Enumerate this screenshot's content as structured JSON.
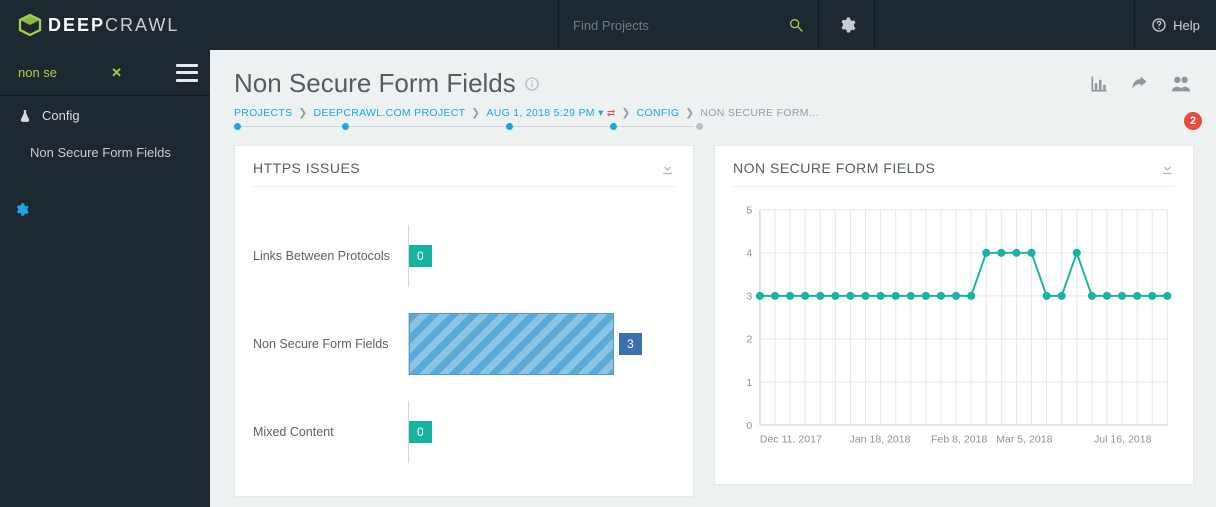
{
  "brand": {
    "bold": "DEEP",
    "light": "CRAWL"
  },
  "topbar": {
    "search_placeholder": "Find Projects",
    "help_label": "Help"
  },
  "sidebar": {
    "filter_text": "non se",
    "items": [
      {
        "icon": "flask",
        "label": "Config"
      },
      {
        "label": "Non Secure Form Fields"
      }
    ]
  },
  "page": {
    "title": "Non Secure Form Fields",
    "badge_count": "2"
  },
  "breadcrumb": [
    {
      "label": "PROJECTS",
      "link": true
    },
    {
      "label": "DEEPCRAWL.COM PROJECT",
      "link": true
    },
    {
      "label": "AUG 1, 2018 5:29 PM",
      "link": true,
      "dropdown": true,
      "compare": true
    },
    {
      "label": "CONFIG",
      "link": true
    },
    {
      "label": "NON SECURE FORM…",
      "link": false
    }
  ],
  "panel_bars": {
    "title": "HTTPS ISSUES",
    "rows": [
      {
        "label": "Links Between Protocols",
        "value": 0,
        "kind": "zero"
      },
      {
        "label": "Non Secure Form Fields",
        "value": 3,
        "kind": "big"
      },
      {
        "label": "Mixed Content",
        "value": 0,
        "kind": "zero"
      }
    ]
  },
  "panel_chart": {
    "title": "NON SECURE FORM FIELDS",
    "x_ticks": [
      "Dec 11, 2017",
      "Jan 18, 2018",
      "Feb 8, 2018",
      "Mar 5, 2018",
      "Jul 16, 2018"
    ]
  },
  "chart_data": {
    "type": "line",
    "title": "NON SECURE FORM FIELDS",
    "ylabel": "",
    "ylim": [
      0,
      5
    ],
    "y_ticks": [
      0,
      1,
      2,
      3,
      4,
      5
    ],
    "x_tick_labels": [
      "Dec 11, 2017",
      "Jan 18, 2018",
      "Feb 8, 2018",
      "Mar 5, 2018",
      "Jul 16, 2018"
    ],
    "series": [
      {
        "name": "Non Secure Form Fields",
        "values": [
          3,
          3,
          3,
          3,
          3,
          3,
          3,
          3,
          3,
          3,
          3,
          3,
          3,
          3,
          3,
          4,
          4,
          4,
          4,
          3,
          3,
          4,
          3,
          3,
          3,
          3,
          3,
          3
        ]
      }
    ]
  }
}
